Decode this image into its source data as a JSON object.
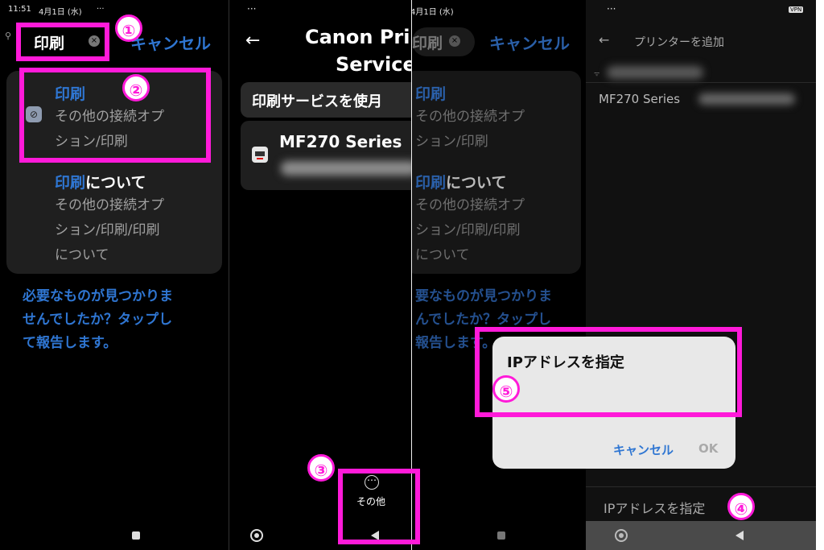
{
  "status": {
    "time": "11:51",
    "date": "4月1日 (水)",
    "dots": "···",
    "vpn": "VPN"
  },
  "search": {
    "query": "印刷",
    "cancel": "キャンセル"
  },
  "results": [
    {
      "title": "印刷",
      "title_rest": "",
      "sub1": "その他の接続オプ",
      "sub2": "ション/印刷",
      "sub3": ""
    },
    {
      "title": "印刷",
      "title_rest": "について",
      "sub1": "その他の接続オプ",
      "sub2": "ション/印刷/印刷",
      "sub3": "について"
    }
  ],
  "feedback": {
    "line1": "必要なものが見つかりま",
    "line2": "せんでしたか？タップし",
    "line3": "て報告します。"
  },
  "feedback_partial": {
    "line1": "要なものが見つかりま",
    "line2": "んでしたか？タップし",
    "line3": "報告します。"
  },
  "panel2": {
    "title1": "Canon Pri",
    "title2": "Service",
    "section": "印刷サービスを使月",
    "printer": "MF270 Series",
    "more_label": "その他",
    "more_icon": "⋯"
  },
  "panel4": {
    "header": "プリンターを追加",
    "wifi": "TP-█████C",
    "printer": "MF270 Series",
    "ip_button": "IPアドレスを指定"
  },
  "dialog": {
    "title": "IPアドレスを指定",
    "cancel": "キャンセル",
    "ok": "OK"
  },
  "badges": {
    "n1": "①",
    "n2": "②",
    "n3": "③",
    "n4": "④",
    "n5": "⑤"
  },
  "colors": {
    "magenta": "#ff1ad9",
    "blue": "#2f76d2",
    "bg": "#000000"
  }
}
